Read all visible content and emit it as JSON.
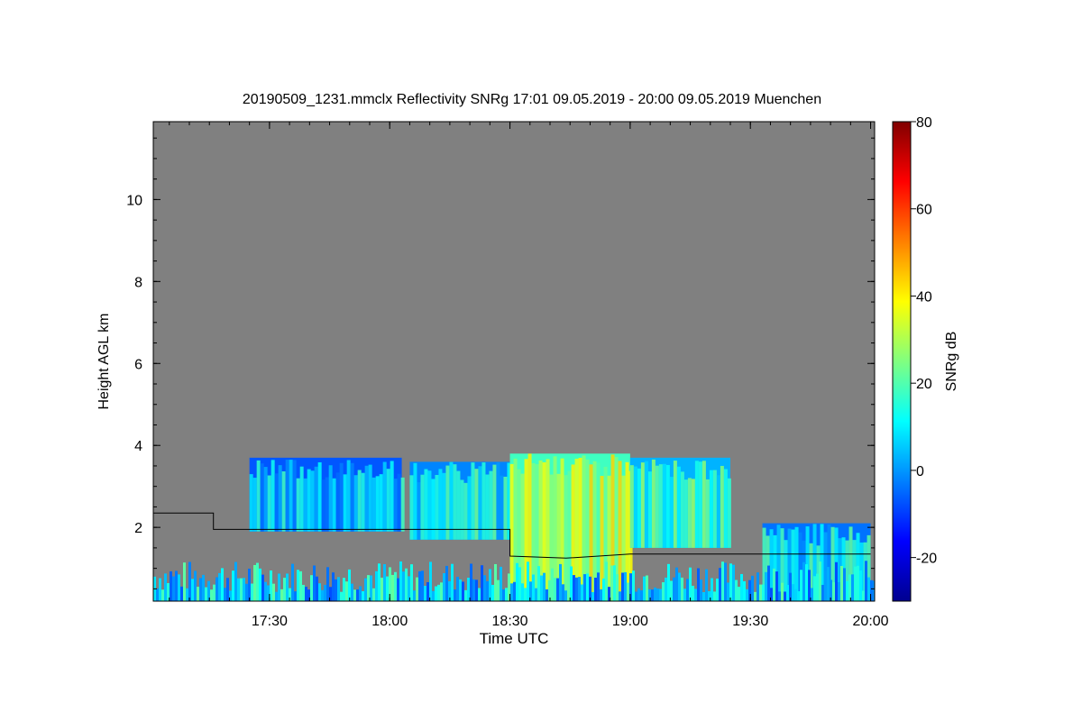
{
  "chart_data": {
    "type": "heatmap",
    "title": "20190509_1231.mmclx Reflectivity SNRg   17:01 09.05.2019 - 20:00 09.05.2019 Muenchen",
    "xlabel": "Time UTC",
    "ylabel": "Height AGL km",
    "colorbar_label": "SNRg dB",
    "x_ticks": [
      "17:30",
      "18:00",
      "18:30",
      "19:00",
      "19:30",
      "20:00"
    ],
    "x_tick_minutes": [
      1050,
      1080,
      1110,
      1140,
      1170,
      1200
    ],
    "xlim_minutes": [
      1021,
      1201
    ],
    "y_ticks": [
      "2",
      "4",
      "6",
      "8",
      "10"
    ],
    "y_tick_values": [
      2,
      4,
      6,
      8,
      10
    ],
    "ylim": [
      0.2,
      11.9
    ],
    "colorbar_ticks": [
      "-20",
      "0",
      "20",
      "40",
      "60",
      "80"
    ],
    "colorbar_tick_values": [
      -20,
      0,
      20,
      40,
      60,
      80
    ],
    "clim": [
      -30,
      80
    ],
    "background_color": "#808080",
    "colormap": [
      "#00008f",
      "#0000ff",
      "#0080ff",
      "#00ffff",
      "#80ff80",
      "#ffff00",
      "#ff8000",
      "#ff0000",
      "#800000"
    ],
    "cloud_layers": [
      {
        "t0": 1045,
        "t1": 1083,
        "top": 3.7,
        "base": 1.9,
        "snr": 5
      },
      {
        "t0": 1085,
        "t1": 1110,
        "top": 3.6,
        "base": 1.7,
        "snr": 10
      },
      {
        "t0": 1110,
        "t1": 1140,
        "top": 3.8,
        "base": 0.2,
        "snr": 30
      },
      {
        "t0": 1140,
        "t1": 1165,
        "top": 3.7,
        "base": 1.5,
        "snr": 15
      },
      {
        "t0": 1173,
        "t1": 1200,
        "top": 2.1,
        "base": 0.2,
        "snr": 8
      }
    ],
    "boundary_line": [
      {
        "t": 1021,
        "h": 2.35
      },
      {
        "t": 1036,
        "h": 2.35
      },
      {
        "t": 1036,
        "h": 1.95
      },
      {
        "t": 1110,
        "h": 1.95
      },
      {
        "t": 1110,
        "h": 1.3
      },
      {
        "t": 1124,
        "h": 1.25
      },
      {
        "t": 1140,
        "h": 1.35
      },
      {
        "t": 1175,
        "h": 1.35
      },
      {
        "t": 1200,
        "h": 1.35
      }
    ]
  }
}
